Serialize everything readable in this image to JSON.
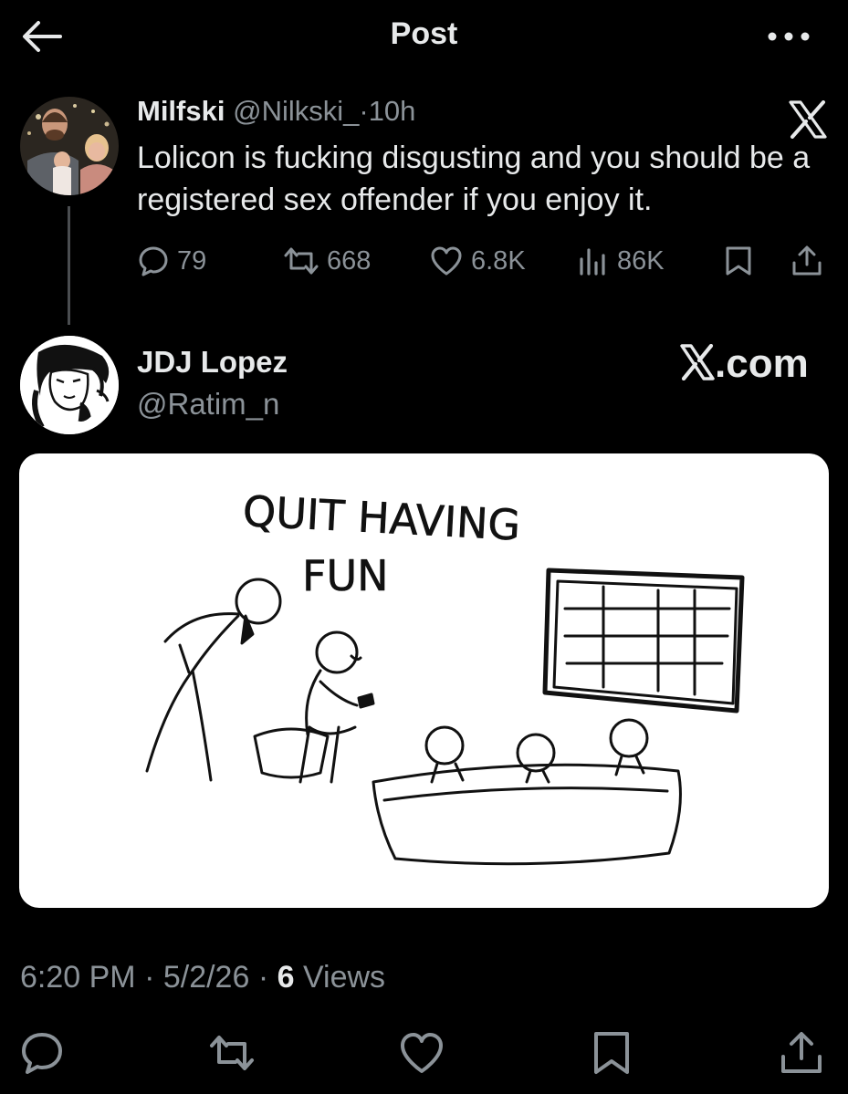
{
  "header": {
    "title": "Post",
    "back_icon": "arrow-left-icon",
    "more_icon": "more-horizontal-icon"
  },
  "quoted_post": {
    "author_name": "Milfski",
    "author_handle": "@Nilkski_",
    "separator": "·",
    "time": "10h",
    "brand_icon": "x-logo-icon",
    "text": "Lolicon is fucking disgusting and you should be a registered sex offender if you enjoy it.",
    "stats": {
      "replies": "79",
      "reposts": "668",
      "likes": "6.8K",
      "views": "86K"
    }
  },
  "main_post": {
    "author_name": "JDJ Lopez",
    "author_handle": "@Ratim_n",
    "brand_text": ".com",
    "comic": {
      "caption_line1": "QUIT HAVING",
      "caption_line2": "FUN"
    },
    "meta": {
      "time": "6:20 PM",
      "sep1": " · ",
      "date": "5/2/26",
      "sep2": " · ",
      "views_count": "6",
      "views_label": " Views"
    }
  },
  "actions": [
    "reply-icon",
    "repost-icon",
    "like-icon",
    "bookmark-icon",
    "share-icon"
  ],
  "colors": {
    "background": "#000000",
    "text": "#e7e9ea",
    "muted": "#8b9298",
    "thread_line": "#4a4d50"
  }
}
